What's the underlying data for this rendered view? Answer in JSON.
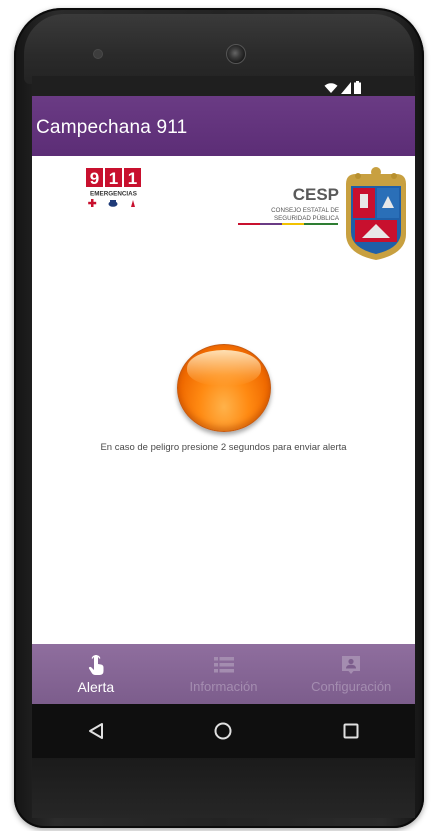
{
  "app": {
    "title": "Campechana 911"
  },
  "status_bar": {
    "icons": [
      "wifi-icon",
      "signal-icon",
      "battery-icon"
    ]
  },
  "header_logos": {
    "left": {
      "digits": [
        "9",
        "1",
        "1"
      ],
      "caption": "EMERGENCIAS"
    },
    "right": {
      "acronym": "CESP",
      "line1": "CONSEJO ESTATAL DE",
      "line2": "SEGURIDAD PÚBLICA"
    }
  },
  "main": {
    "alert_button_icon": "orange-alert-button",
    "hint": "En caso de peligro presione 2 segundos para enviar alerta"
  },
  "bottom_nav": {
    "items": [
      {
        "label": "Alerta",
        "icon": "touch-hand-icon",
        "active": true
      },
      {
        "label": "Información",
        "icon": "list-icon",
        "active": false
      },
      {
        "label": "Configuración",
        "icon": "contact-card-icon",
        "active": false
      }
    ]
  },
  "system_nav": {
    "buttons": [
      "back-icon",
      "home-icon",
      "recents-icon"
    ]
  },
  "colors": {
    "app_bar": "#5c2d76",
    "bottom_nav": "#8f6e9e",
    "accent_button": "#ff8a12",
    "inactive_label": "#a48db0"
  }
}
